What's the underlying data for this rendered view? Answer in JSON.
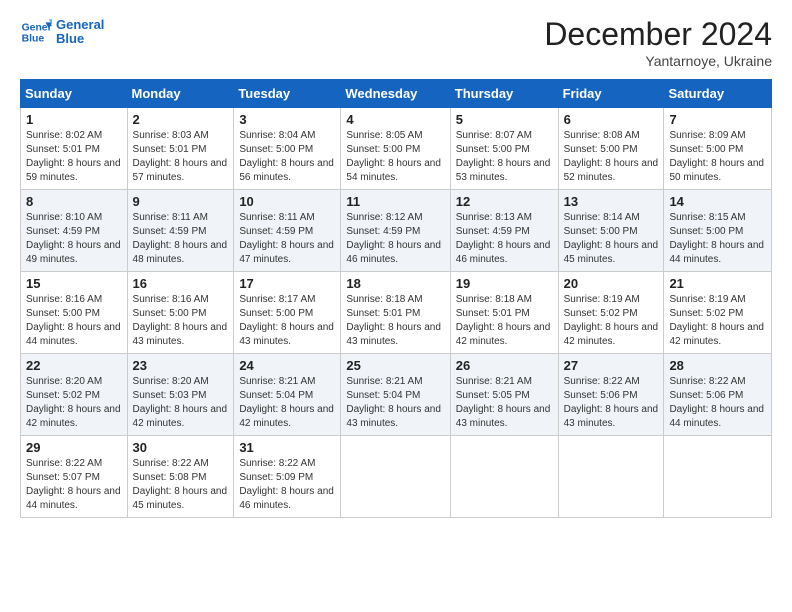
{
  "logo": {
    "line1": "General",
    "line2": "Blue"
  },
  "title": "December 2024",
  "subtitle": "Yantarnoye, Ukraine",
  "days_of_week": [
    "Sunday",
    "Monday",
    "Tuesday",
    "Wednesday",
    "Thursday",
    "Friday",
    "Saturday"
  ],
  "weeks": [
    [
      {
        "day": "1",
        "sunrise": "8:02 AM",
        "sunset": "5:01 PM",
        "daylight": "8 hours and 59 minutes."
      },
      {
        "day": "2",
        "sunrise": "8:03 AM",
        "sunset": "5:01 PM",
        "daylight": "8 hours and 57 minutes."
      },
      {
        "day": "3",
        "sunrise": "8:04 AM",
        "sunset": "5:00 PM",
        "daylight": "8 hours and 56 minutes."
      },
      {
        "day": "4",
        "sunrise": "8:05 AM",
        "sunset": "5:00 PM",
        "daylight": "8 hours and 54 minutes."
      },
      {
        "day": "5",
        "sunrise": "8:07 AM",
        "sunset": "5:00 PM",
        "daylight": "8 hours and 53 minutes."
      },
      {
        "day": "6",
        "sunrise": "8:08 AM",
        "sunset": "5:00 PM",
        "daylight": "8 hours and 52 minutes."
      },
      {
        "day": "7",
        "sunrise": "8:09 AM",
        "sunset": "5:00 PM",
        "daylight": "8 hours and 50 minutes."
      }
    ],
    [
      {
        "day": "8",
        "sunrise": "8:10 AM",
        "sunset": "4:59 PM",
        "daylight": "8 hours and 49 minutes."
      },
      {
        "day": "9",
        "sunrise": "8:11 AM",
        "sunset": "4:59 PM",
        "daylight": "8 hours and 48 minutes."
      },
      {
        "day": "10",
        "sunrise": "8:11 AM",
        "sunset": "4:59 PM",
        "daylight": "8 hours and 47 minutes."
      },
      {
        "day": "11",
        "sunrise": "8:12 AM",
        "sunset": "4:59 PM",
        "daylight": "8 hours and 46 minutes."
      },
      {
        "day": "12",
        "sunrise": "8:13 AM",
        "sunset": "4:59 PM",
        "daylight": "8 hours and 46 minutes."
      },
      {
        "day": "13",
        "sunrise": "8:14 AM",
        "sunset": "5:00 PM",
        "daylight": "8 hours and 45 minutes."
      },
      {
        "day": "14",
        "sunrise": "8:15 AM",
        "sunset": "5:00 PM",
        "daylight": "8 hours and 44 minutes."
      }
    ],
    [
      {
        "day": "15",
        "sunrise": "8:16 AM",
        "sunset": "5:00 PM",
        "daylight": "8 hours and 44 minutes."
      },
      {
        "day": "16",
        "sunrise": "8:16 AM",
        "sunset": "5:00 PM",
        "daylight": "8 hours and 43 minutes."
      },
      {
        "day": "17",
        "sunrise": "8:17 AM",
        "sunset": "5:00 PM",
        "daylight": "8 hours and 43 minutes."
      },
      {
        "day": "18",
        "sunrise": "8:18 AM",
        "sunset": "5:01 PM",
        "daylight": "8 hours and 43 minutes."
      },
      {
        "day": "19",
        "sunrise": "8:18 AM",
        "sunset": "5:01 PM",
        "daylight": "8 hours and 42 minutes."
      },
      {
        "day": "20",
        "sunrise": "8:19 AM",
        "sunset": "5:02 PM",
        "daylight": "8 hours and 42 minutes."
      },
      {
        "day": "21",
        "sunrise": "8:19 AM",
        "sunset": "5:02 PM",
        "daylight": "8 hours and 42 minutes."
      }
    ],
    [
      {
        "day": "22",
        "sunrise": "8:20 AM",
        "sunset": "5:02 PM",
        "daylight": "8 hours and 42 minutes."
      },
      {
        "day": "23",
        "sunrise": "8:20 AM",
        "sunset": "5:03 PM",
        "daylight": "8 hours and 42 minutes."
      },
      {
        "day": "24",
        "sunrise": "8:21 AM",
        "sunset": "5:04 PM",
        "daylight": "8 hours and 42 minutes."
      },
      {
        "day": "25",
        "sunrise": "8:21 AM",
        "sunset": "5:04 PM",
        "daylight": "8 hours and 43 minutes."
      },
      {
        "day": "26",
        "sunrise": "8:21 AM",
        "sunset": "5:05 PM",
        "daylight": "8 hours and 43 minutes."
      },
      {
        "day": "27",
        "sunrise": "8:22 AM",
        "sunset": "5:06 PM",
        "daylight": "8 hours and 43 minutes."
      },
      {
        "day": "28",
        "sunrise": "8:22 AM",
        "sunset": "5:06 PM",
        "daylight": "8 hours and 44 minutes."
      }
    ],
    [
      {
        "day": "29",
        "sunrise": "8:22 AM",
        "sunset": "5:07 PM",
        "daylight": "8 hours and 44 minutes."
      },
      {
        "day": "30",
        "sunrise": "8:22 AM",
        "sunset": "5:08 PM",
        "daylight": "8 hours and 45 minutes."
      },
      {
        "day": "31",
        "sunrise": "8:22 AM",
        "sunset": "5:09 PM",
        "daylight": "8 hours and 46 minutes."
      },
      null,
      null,
      null,
      null
    ]
  ]
}
